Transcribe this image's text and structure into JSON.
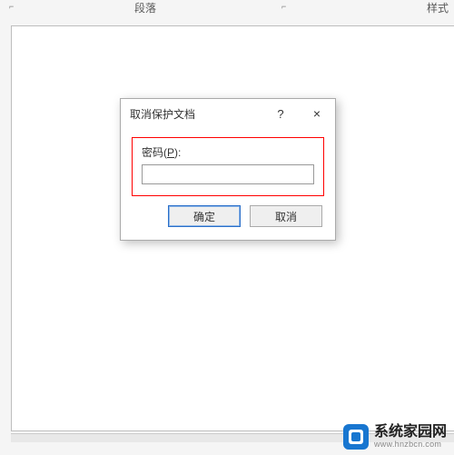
{
  "ribbon": {
    "paragraph_label": "段落",
    "styles_label": "样式"
  },
  "dialog": {
    "title": "取消保护文档",
    "help_symbol": "?",
    "close_symbol": "×",
    "password_label_prefix": "密码(",
    "password_mnemonic": "P",
    "password_label_suffix": "):",
    "password_value": "",
    "ok_label": "确定",
    "cancel_label": "取消"
  },
  "watermark": {
    "main": "系统家园网",
    "sub": "www.hnzbcn.com"
  }
}
